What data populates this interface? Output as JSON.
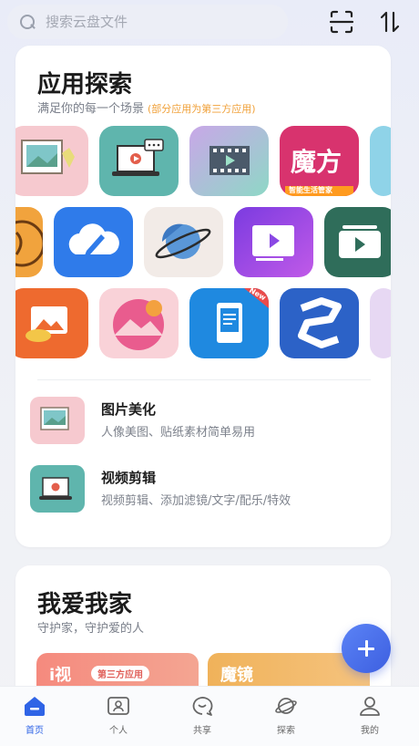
{
  "search": {
    "placeholder": "搜索云盘文件",
    "value": ""
  },
  "toolbar": {
    "scan_icon": "scan-icon",
    "sort_icon": "sort-icon"
  },
  "explore": {
    "title": "应用探索",
    "subtitle": "满足你的每一个场景",
    "note": "(部分应用为第三方应用)",
    "tile_text": {
      "mofang": "魔方",
      "mofang_caption": "智能生活管家",
      "new_badge": "New"
    },
    "list": [
      {
        "title": "图片美化",
        "desc": "人像美图、贴纸素材简单易用"
      },
      {
        "title": "视频剪辑",
        "desc": "视频剪辑、添加滤镜/文字/配乐/特效"
      }
    ]
  },
  "family": {
    "title": "我爱我家",
    "subtitle": "守护家，守护爱的人",
    "banners": [
      {
        "label": "i视",
        "badge": "第三方应用"
      },
      {
        "label": "魔镜"
      }
    ]
  },
  "nav": [
    {
      "label": "首页",
      "active": true
    },
    {
      "label": "个人"
    },
    {
      "label": "共享"
    },
    {
      "label": "探索"
    },
    {
      "label": "我的"
    }
  ],
  "colors": {
    "accent": "#2f64e6",
    "fab": "#4a6ff0",
    "note": "#f0a13a"
  }
}
